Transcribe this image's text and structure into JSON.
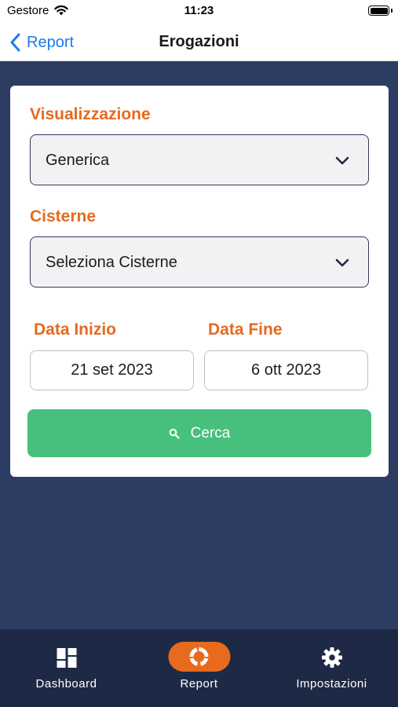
{
  "status_bar": {
    "carrier": "Gestore",
    "time": "11:23",
    "wifi_icon": "wifi-icon",
    "battery_icon": "battery-icon"
  },
  "nav": {
    "back_label": "Report",
    "title": "Erogazioni"
  },
  "form": {
    "visualizzazione_label": "Visualizzazione",
    "visualizzazione_value": "Generica",
    "cisterne_label": "Cisterne",
    "cisterne_value": "Seleziona Cisterne",
    "data_inizio_label": "Data Inizio",
    "data_inizio_value": "21 set 2023",
    "data_fine_label": "Data Fine",
    "data_fine_value": "6 ott 2023",
    "search_label": "Cerca"
  },
  "tabs": [
    {
      "label": "Dashboard",
      "icon": "dashboard-icon",
      "active": false
    },
    {
      "label": "Report",
      "icon": "report-icon",
      "active": true
    },
    {
      "label": "Impostazioni",
      "icon": "gear-icon",
      "active": false
    }
  ],
  "colors": {
    "background": "#2d3c63",
    "accent_orange": "#e46a1f",
    "search_green": "#47c07e",
    "ios_blue": "#1f7ae8",
    "tab_bar": "#1e2a45"
  }
}
